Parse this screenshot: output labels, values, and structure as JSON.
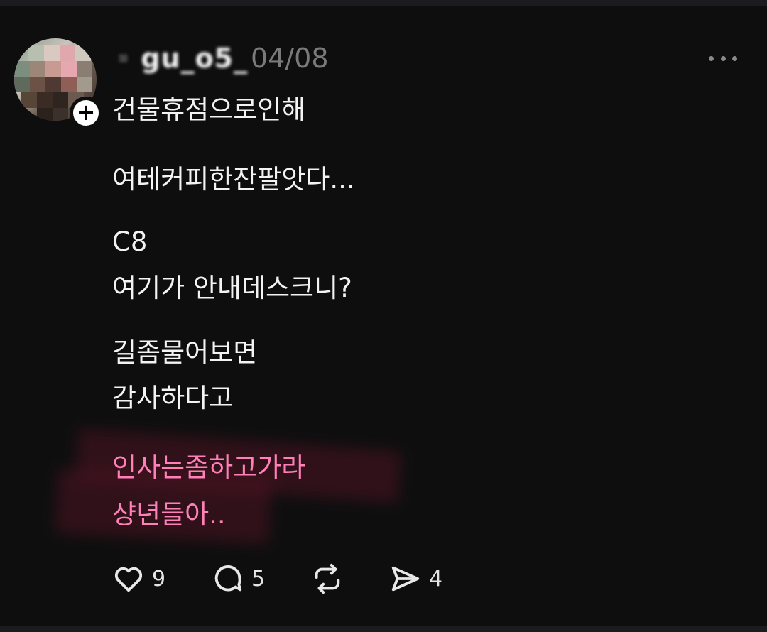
{
  "post": {
    "username": "▪️gu_o5_",
    "date": "04/08",
    "lines": [
      "건물휴점으로인해",
      "여테커피한잔팔앗다...",
      "C8",
      "여기가 안내데스크니?",
      "길좀물어보면",
      "감사하다고",
      "인사는좀하고가라",
      "샹년들아.."
    ]
  },
  "actions": {
    "likes": "9",
    "comments": "5",
    "shares": "4"
  },
  "icons": [
    "heart-icon",
    "comment-icon",
    "repost-icon",
    "send-icon",
    "more-icon",
    "plus-icon"
  ],
  "colors": {
    "background": "#0e0e0f",
    "text": "#f3f3f3",
    "highlight": "#ff7fb8",
    "muted": "#7a7a7a"
  }
}
